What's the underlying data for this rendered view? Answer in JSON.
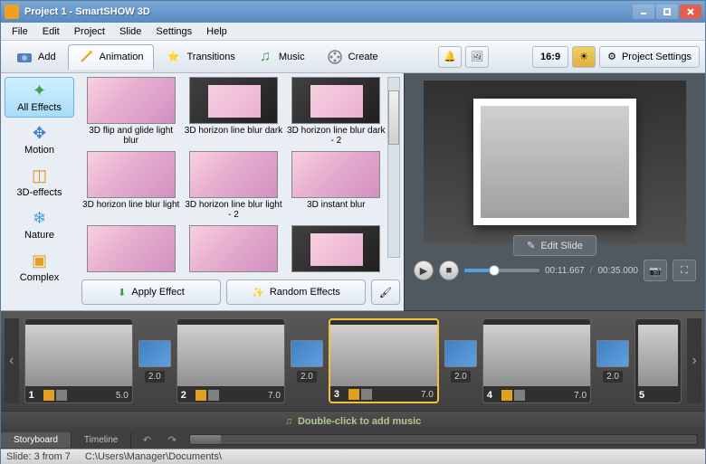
{
  "window": {
    "title": "Project 1 - SmartSHOW 3D"
  },
  "menu": {
    "items": [
      "File",
      "Edit",
      "Project",
      "Slide",
      "Settings",
      "Help"
    ]
  },
  "toptabs": {
    "items": [
      {
        "id": "add",
        "label": "Add"
      },
      {
        "id": "animation",
        "label": "Animation"
      },
      {
        "id": "transitions",
        "label": "Transitions"
      },
      {
        "id": "music",
        "label": "Music"
      },
      {
        "id": "create",
        "label": "Create"
      }
    ],
    "active": "animation",
    "ratio": "16:9",
    "settings_label": "Project Settings"
  },
  "effects": {
    "categories": [
      {
        "id": "all",
        "label": "All Effects"
      },
      {
        "id": "motion",
        "label": "Motion"
      },
      {
        "id": "3d",
        "label": "3D-effects"
      },
      {
        "id": "nature",
        "label": "Nature"
      },
      {
        "id": "complex",
        "label": "Complex"
      }
    ],
    "active_category": "all",
    "items": [
      "3D flip and glide light blur",
      "3D horizon line blur dark",
      "3D horizon line blur dark - 2",
      "3D horizon line blur light",
      "3D horizon line blur light - 2",
      "3D instant blur",
      "",
      "",
      ""
    ],
    "apply_label": "Apply Effect",
    "random_label": "Random Effects"
  },
  "preview": {
    "edit_label": "Edit Slide",
    "time_current": "00:11.667",
    "time_total": "00:35.000"
  },
  "timeline": {
    "slides": [
      {
        "num": "1",
        "dur": "5.0"
      },
      {
        "num": "2",
        "dur": "7.0"
      },
      {
        "num": "3",
        "dur": "7.0"
      },
      {
        "num": "4",
        "dur": "7.0"
      },
      {
        "num": "5",
        "dur": ""
      }
    ],
    "transitions": [
      {
        "dur": "2.0"
      },
      {
        "dur": "2.0"
      },
      {
        "dur": "2.0"
      },
      {
        "dur": "2.0"
      }
    ],
    "selected_slide": 2,
    "music_hint": "Double-click to add music"
  },
  "bottombar": {
    "storyboard_label": "Storyboard",
    "timeline_label": "Timeline"
  },
  "status": {
    "slide_info": "Slide: 3 from 7",
    "path": "C:\\Users\\Manager\\Documents\\"
  }
}
